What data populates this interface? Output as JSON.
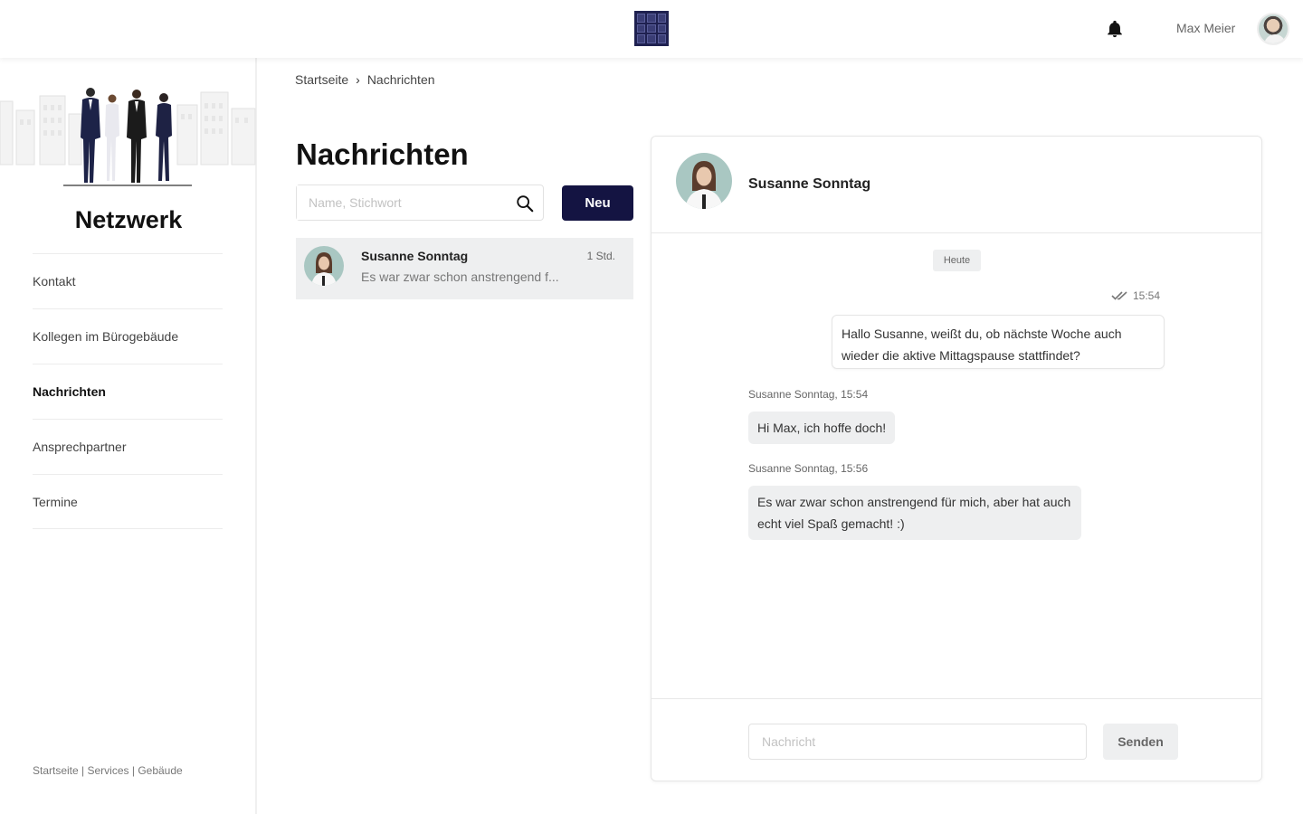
{
  "header": {
    "username": "Max Meier"
  },
  "sidebar": {
    "title": "Netzwerk",
    "items": [
      {
        "label": "Kontakt",
        "active": false
      },
      {
        "label": "Kollegen im Bürogebäude",
        "active": false
      },
      {
        "label": "Nachrichten",
        "active": true
      },
      {
        "label": "Ansprechpartner",
        "active": false
      },
      {
        "label": "Termine",
        "active": false
      }
    ],
    "footer": {
      "link1": "Startseite",
      "link2": "Services",
      "link3": "Gebäude",
      "separator": " | "
    }
  },
  "breadcrumb": {
    "home": "Startseite",
    "separator": "›",
    "current": "Nachrichten"
  },
  "messages_list": {
    "title": "Nachrichten",
    "search_placeholder": "Name, Stichwort",
    "new_button": "Neu",
    "conversations": [
      {
        "name": "Susanne Sonntag",
        "time": "1 Std.",
        "preview": "Es war zwar schon anstrengend f..."
      }
    ]
  },
  "chat": {
    "contact_name": "Susanne Sonntag",
    "day_label": "Heute",
    "sent_time": "15:54",
    "messages": [
      {
        "direction": "out",
        "text": "Hallo Susanne, weißt du, ob nächste Woche auch wieder die aktive Mittagspause stattfindet?"
      },
      {
        "direction": "in",
        "meta": "Susanne Sonntag, 15:54",
        "text": "Hi Max, ich hoffe doch!"
      },
      {
        "direction": "in",
        "meta": "Susanne Sonntag, 15:56",
        "text": "Es war zwar schon anstrengend für mich, aber hat auch echt viel Spaß gemacht! :)"
      }
    ],
    "input_placeholder": "Nachricht",
    "send_button": "Senden"
  },
  "colors": {
    "primary": "#141442",
    "bubble_bg": "#eeeff0"
  },
  "icons": [
    "logo-icon",
    "bell-icon",
    "search-icon",
    "chevron-right-icon",
    "double-check-icon"
  ]
}
